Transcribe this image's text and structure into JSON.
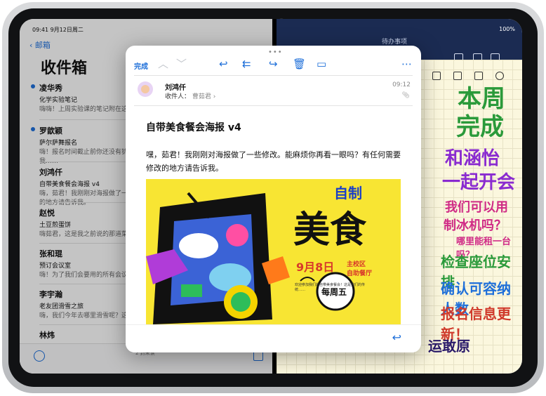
{
  "mail": {
    "status_time": "09:41  9月12日周二",
    "back_label": "邮箱",
    "title": "收件箱",
    "messages": [
      {
        "sender": "凌华秀",
        "subject": "化学实验笔记",
        "preview": "嗨嗨！上周实验课的笔记附在这封邮件里了。你能看看我们写得对不对吗？",
        "unread": true
      },
      {
        "sender": "罗歆颖",
        "subject": "萨尔萨舞报名",
        "preview": "嗨！报名时间截止前你还没有犹豫的话，来一起报名吧？如果你想加入的话，我……",
        "unread": true
      },
      {
        "sender": "刘鸿仟",
        "subject": "自带美食餐会海报 v4",
        "preview": "嗨，茹君！我刚刚对海报做了一些修改。能麻烦你再看一眼吗？有任何需要修改的地方请告诉我。",
        "unread": false
      },
      {
        "sender": "赵悦",
        "subject": "土豆煎蛋饼",
        "preview": "嗨茹君，这是我之前说的那道菜的做法，我已经把它写在我的笔记里了……",
        "unread": false
      },
      {
        "sender": "张和琨",
        "subject": "预订会议室",
        "preview": "嗨！为了我们会要用的所有会议室预订信息，请查收附件……",
        "unread": false
      },
      {
        "sender": "李宇瀚",
        "subject": "老友团滑雪之旅",
        "preview": "嗨，我们今年去哪里滑雪呢？这一次是九个人……",
        "unread": false
      },
      {
        "sender": "林炜",
        "subject": "",
        "preview": "",
        "unread": false
      }
    ],
    "bottom_text": "2 封未读"
  },
  "notes": {
    "title": "待办事项",
    "status_right": "100%",
    "lines": [
      "本周",
      "完成",
      "和涵怡",
      "一起开会",
      "我们可以用",
      "制冰机吗？",
      "哪里能租一台吗？",
      "检查座位安排",
      "确认可容纳人数",
      "报名信息更新！",
      "运敢原"
    ]
  },
  "email": {
    "done_label": "完成",
    "from_name": "刘鸿仟",
    "to_label": "收件人：",
    "to_name": "曹茹君 ›",
    "time": "09:12",
    "subject": "自带美食餐会海报 v4",
    "body": "嘿，茹君！我刚刚对海报做了一些修改。能麻烦你再看一眼吗？有任何需要修改的地方请告诉我。",
    "poster": {
      "line1": "自制",
      "line2": "美食",
      "date": "9月8日",
      "place1": "主校区",
      "place2": "自助餐厅",
      "badge": "每周五",
      "small_text": "欢迎参加我们的自带美食餐会！这是我们的传统……"
    }
  },
  "colors": {
    "accent": "#1e6fd9",
    "notes_bg": "#1b2b52",
    "poster_yellow": "#f8e533"
  }
}
